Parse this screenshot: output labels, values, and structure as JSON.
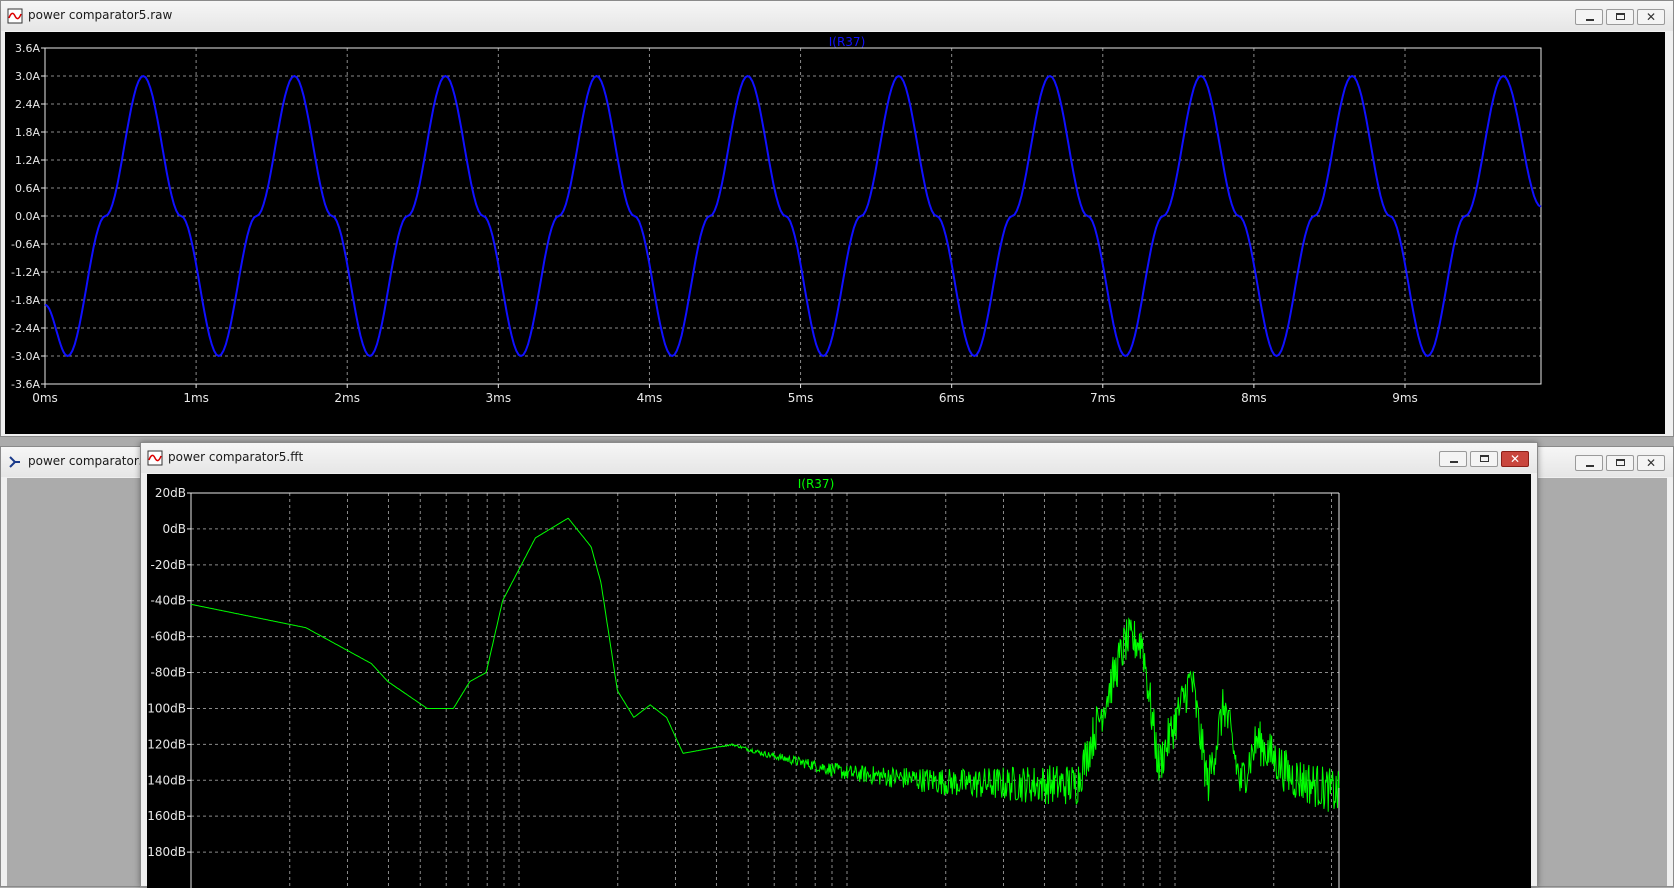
{
  "windows": {
    "raw": {
      "title": "power comparator5.raw"
    },
    "asc": {
      "title": "power comparator5.a"
    },
    "fft": {
      "title": "power comparator5.fft"
    }
  },
  "colors": {
    "raw_trace": "#1010ff",
    "fft_trace": "#00ff00",
    "grid": "#8a8a8a",
    "axis_text": "#e8e8e8"
  },
  "chart_data": [
    {
      "type": "line",
      "trace_label": "I(R37)",
      "ylim": [
        -3.6,
        3.6
      ],
      "xlim": [
        0,
        9.9
      ],
      "y_ticks": [
        "3.6A",
        "3.0A",
        "2.4A",
        "1.8A",
        "1.2A",
        "0.6A",
        "0.0A",
        "-0.6A",
        "-1.2A",
        "-1.8A",
        "-2.4A",
        "-3.0A",
        "-3.6A"
      ],
      "x_ticks": [
        "0ms",
        "1ms",
        "2ms",
        "3ms",
        "4ms",
        "5ms",
        "6ms",
        "7ms",
        "8ms",
        "9ms"
      ],
      "series": [
        {
          "x": [
            0,
            0.15,
            0.4,
            0.65,
            0.9,
            1.15,
            1.4,
            1.65,
            1.9,
            2.15,
            2.4,
            2.65,
            2.9,
            3.15,
            3.4,
            3.65,
            3.9,
            4.15,
            4.4,
            4.65,
            4.9,
            5.15,
            5.4,
            5.65,
            5.9,
            6.15,
            6.4,
            6.65,
            6.9,
            7.15,
            7.4,
            7.65,
            7.9,
            8.15,
            8.4,
            8.65,
            8.9,
            9.15,
            9.4,
            9.65,
            9.9
          ],
          "y": [
            -1.9,
            -3.0,
            0,
            3.0,
            0,
            -3.0,
            0,
            3.0,
            0,
            -3.0,
            0,
            3.0,
            0,
            -3.0,
            0,
            3.0,
            0,
            -3.0,
            0,
            3.0,
            0,
            -3.0,
            0,
            3.0,
            0,
            -3.0,
            0,
            3.0,
            0,
            -3.0,
            0,
            3.0,
            0,
            -3.0,
            0,
            3.0,
            0,
            -3.0,
            0,
            3.0,
            0.2
          ]
        }
      ]
    },
    {
      "type": "line",
      "trace_label": "I(R37)",
      "ylim": [
        -200,
        20
      ],
      "y_ticks": [
        "20dB",
        "0dB",
        "-20dB",
        "-40dB",
        "-60dB",
        "-80dB",
        "-100dB",
        "-120dB",
        "-140dB",
        "-160dB",
        "-180dB"
      ],
      "x_scale": "log",
      "xlim_decades": [
        0,
        3.5
      ],
      "series": [
        {
          "x_decades": [
            0,
            0.35,
            0.55,
            0.6,
            0.72,
            0.8,
            0.85,
            0.9,
            0.95,
            1.05,
            1.15,
            1.22,
            1.25,
            1.3,
            1.35,
            1.4,
            1.45,
            1.5,
            1.65,
            1.75,
            2.0,
            2.35,
            2.7,
            2.85,
            2.9,
            2.95,
            3.05,
            3.1,
            3.15,
            3.2,
            3.25,
            3.35,
            3.5
          ],
          "y": [
            -42,
            -55,
            -75,
            -85,
            -100,
            -100,
            -85,
            -80,
            -40,
            -5,
            6,
            -10,
            -30,
            -90,
            -105,
            -98,
            -105,
            -125,
            -120,
            -125,
            -135,
            -140,
            -140,
            -60,
            -60,
            -130,
            -80,
            -140,
            -95,
            -140,
            -115,
            -135,
            -145
          ]
        }
      ]
    }
  ]
}
